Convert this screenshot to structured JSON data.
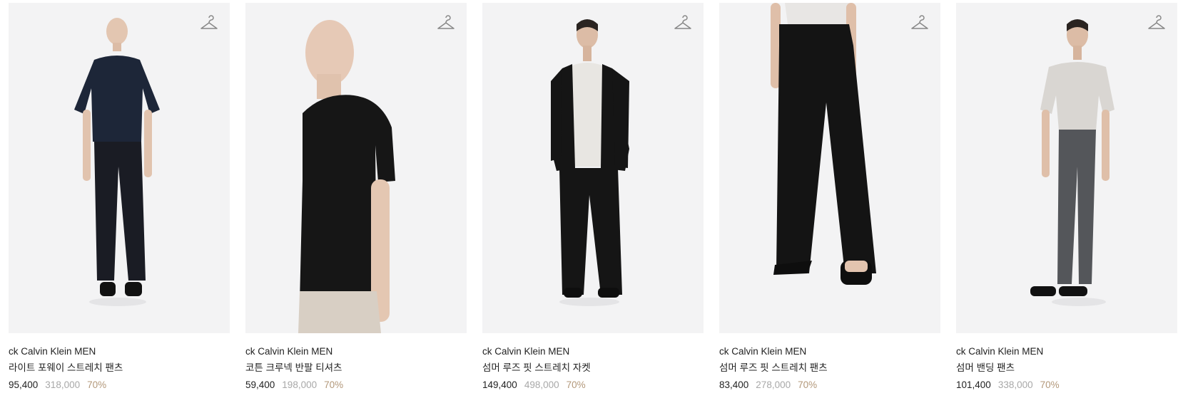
{
  "products": [
    {
      "brand": "ck Calvin Klein MEN",
      "name": "라이트 포웨이 스트레치 팬츠",
      "sale_price": "95,400",
      "original_price": "318,000",
      "discount": "70%",
      "icon": "hanger-icon",
      "colors": {
        "top": "#1d2638",
        "bottom": "#1a1c24"
      }
    },
    {
      "brand": "ck Calvin Klein MEN",
      "name": "코튼 크루넥 반팔 티셔츠",
      "sale_price": "59,400",
      "original_price": "198,000",
      "discount": "70%",
      "icon": "hanger-icon",
      "colors": {
        "top": "#161616",
        "bottom": "#d8cfc4"
      }
    },
    {
      "brand": "ck Calvin Klein MEN",
      "name": "섬머 루즈 핏 스트레치 자켓",
      "sale_price": "149,400",
      "original_price": "498,000",
      "discount": "70%",
      "icon": "hanger-icon",
      "colors": {
        "top": "#151515",
        "bottom": "#151515"
      }
    },
    {
      "brand": "ck Calvin Klein MEN",
      "name": "섬머 루즈 핏 스트레치 팬츠",
      "sale_price": "83,400",
      "original_price": "278,000",
      "discount": "70%",
      "icon": "hanger-icon",
      "colors": {
        "top": "#e8e6e4",
        "bottom": "#141414"
      }
    },
    {
      "brand": "ck Calvin Klein MEN",
      "name": "섬머 밴딩 팬츠",
      "sale_price": "101,400",
      "original_price": "338,000",
      "discount": "70%",
      "icon": "hanger-icon",
      "colors": {
        "top": "#d9d6d2",
        "bottom": "#54565a"
      }
    }
  ]
}
